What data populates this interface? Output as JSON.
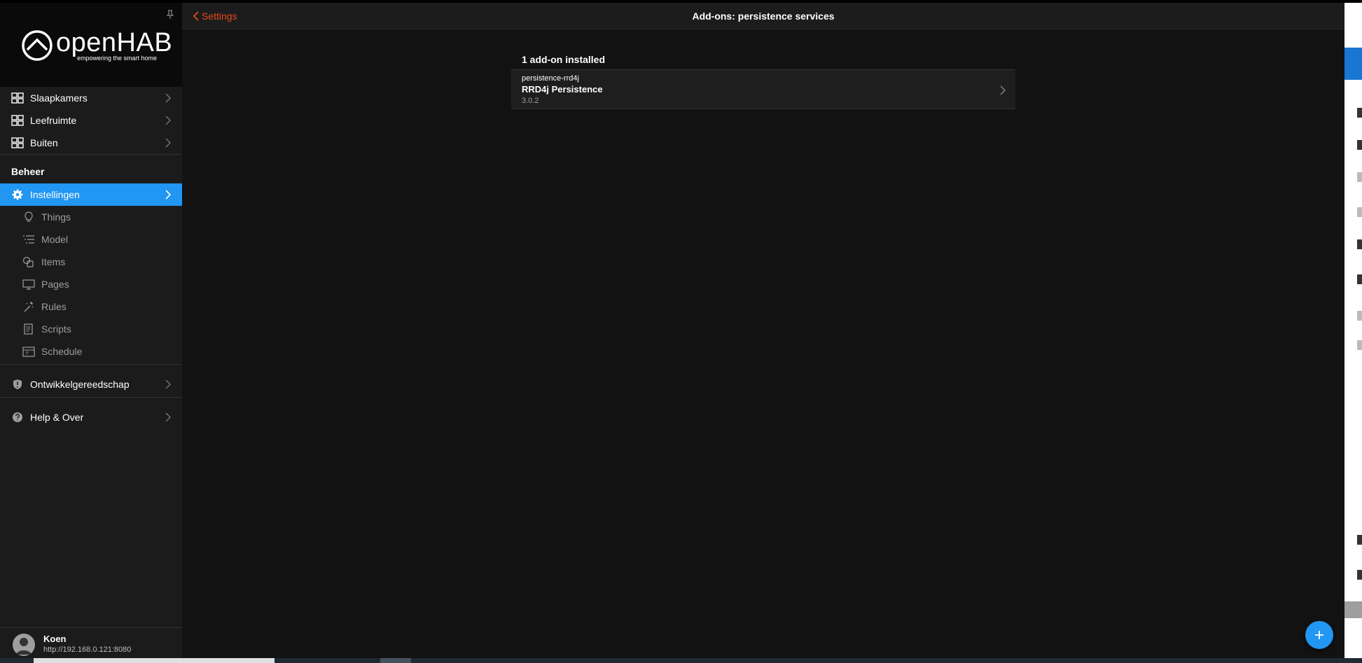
{
  "sidebar": {
    "logo_text": "openHAB",
    "logo_tagline": "empowering the smart home",
    "locations": [
      {
        "label": "Slaapkamers"
      },
      {
        "label": "Leefruimte"
      },
      {
        "label": "Buiten"
      }
    ],
    "section_title": "Beheer",
    "settings_label": "Instellingen",
    "sub_items": [
      {
        "label": "Things",
        "icon": "lightbulb-icon"
      },
      {
        "label": "Model",
        "icon": "list-tree-icon"
      },
      {
        "label": "Items",
        "icon": "items-icon"
      },
      {
        "label": "Pages",
        "icon": "monitor-icon"
      },
      {
        "label": "Rules",
        "icon": "wand-icon"
      },
      {
        "label": "Scripts",
        "icon": "document-icon"
      },
      {
        "label": "Schedule",
        "icon": "calendar-icon"
      }
    ],
    "developer_label": "Ontwikkelgereedschap",
    "help_label": "Help & Over",
    "user": {
      "name": "Koen",
      "url": "http://192.168.0.121:8080"
    }
  },
  "navbar": {
    "back_label": "Settings",
    "title": "Add-ons: persistence services"
  },
  "content": {
    "block_title": "1 add-on installed",
    "addons": [
      {
        "id": "persistence-rrd4j",
        "name": "RRD4j Persistence",
        "version": "3.0.2"
      }
    ]
  },
  "colors": {
    "accent": "#2196f3",
    "back_link": "#e64a19",
    "background": "#121212",
    "sidebar": "#1b1b1b"
  }
}
